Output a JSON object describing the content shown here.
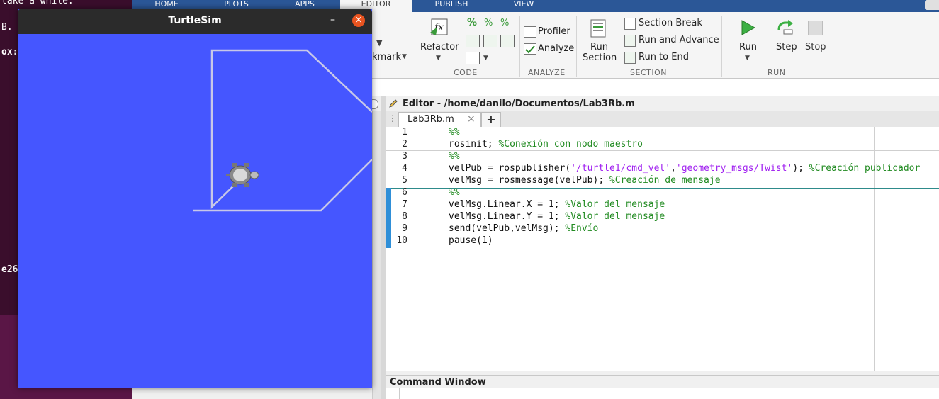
{
  "terminal": {
    "lines": [
      "take a while.",
      "B.",
      "ox:",
      "e26"
    ]
  },
  "matlab": {
    "tabs": [
      "HOME",
      "PLOTS",
      "APPS",
      "EDITOR",
      "PUBLISH",
      "VIEW"
    ],
    "toolstrip": {
      "navigate_partial": "kmark",
      "refactor_label": "Refactor",
      "code_group": "CODE",
      "profiler_label": "Profiler",
      "analyze_label": "Analyze",
      "analyze_group": "ANALYZE",
      "run_section_label_1": "Run",
      "run_section_label_2": "Section",
      "section_break_label": "Section Break",
      "run_and_advance_label": "Run and Advance",
      "run_to_end_label": "Run to End",
      "section_group": "SECTION",
      "run_label": "Run",
      "step_label": "Step",
      "stop_label": "Stop",
      "run_group": "RUN"
    },
    "editor": {
      "title": "Editor - /home/danilo/Documentos/Lab3Rb.m",
      "file_tab": "Lab3Rb.m",
      "add_tab_label": "+",
      "close_tab_label": "×",
      "lines": [
        {
          "n": "1",
          "parts": [
            {
              "t": "%%",
              "c": "kw"
            }
          ]
        },
        {
          "n": "2",
          "parts": [
            {
              "t": "rosinit; ",
              "c": ""
            },
            {
              "t": "%Conexión con nodo maestro",
              "c": "kw"
            }
          ]
        },
        {
          "n": "3",
          "parts": [
            {
              "t": "%%",
              "c": "kw"
            }
          ]
        },
        {
          "n": "4",
          "parts": [
            {
              "t": "velPub = rospublisher(",
              "c": ""
            },
            {
              "t": "'/turtle1/cmd_vel'",
              "c": "str"
            },
            {
              "t": ",",
              "c": ""
            },
            {
              "t": "'geometry_msgs/Twist'",
              "c": "str"
            },
            {
              "t": "); ",
              "c": ""
            },
            {
              "t": "%Creación publicador",
              "c": "kw"
            }
          ]
        },
        {
          "n": "5",
          "parts": [
            {
              "t": "velMsg = rosmessage(velPub); ",
              "c": ""
            },
            {
              "t": "%Creación de mensaje",
              "c": "kw"
            }
          ]
        },
        {
          "n": "6",
          "parts": [
            {
              "t": "%%",
              "c": "kw"
            }
          ]
        },
        {
          "n": "7",
          "parts": [
            {
              "t": "velMsg.Linear.X = 1; ",
              "c": ""
            },
            {
              "t": "%Valor del mensaje",
              "c": "kw"
            }
          ]
        },
        {
          "n": "8",
          "parts": [
            {
              "t": "velMsg.Linear.Y = 1; ",
              "c": ""
            },
            {
              "t": "%Valor del mensaje",
              "c": "kw"
            }
          ]
        },
        {
          "n": "9",
          "parts": [
            {
              "t": "send(velPub,velMsg); ",
              "c": ""
            },
            {
              "t": "%Envío",
              "c": "kw"
            }
          ]
        },
        {
          "n": "10",
          "parts": [
            {
              "t": "pause(1)",
              "c": ""
            }
          ]
        }
      ]
    },
    "command_window_title": "Command Window"
  },
  "turtlesim": {
    "title": "TurtleSim",
    "minimize_label": "–",
    "close_label": "×",
    "background_color": "#4556ff",
    "trail_color": "#c8c8e8"
  }
}
